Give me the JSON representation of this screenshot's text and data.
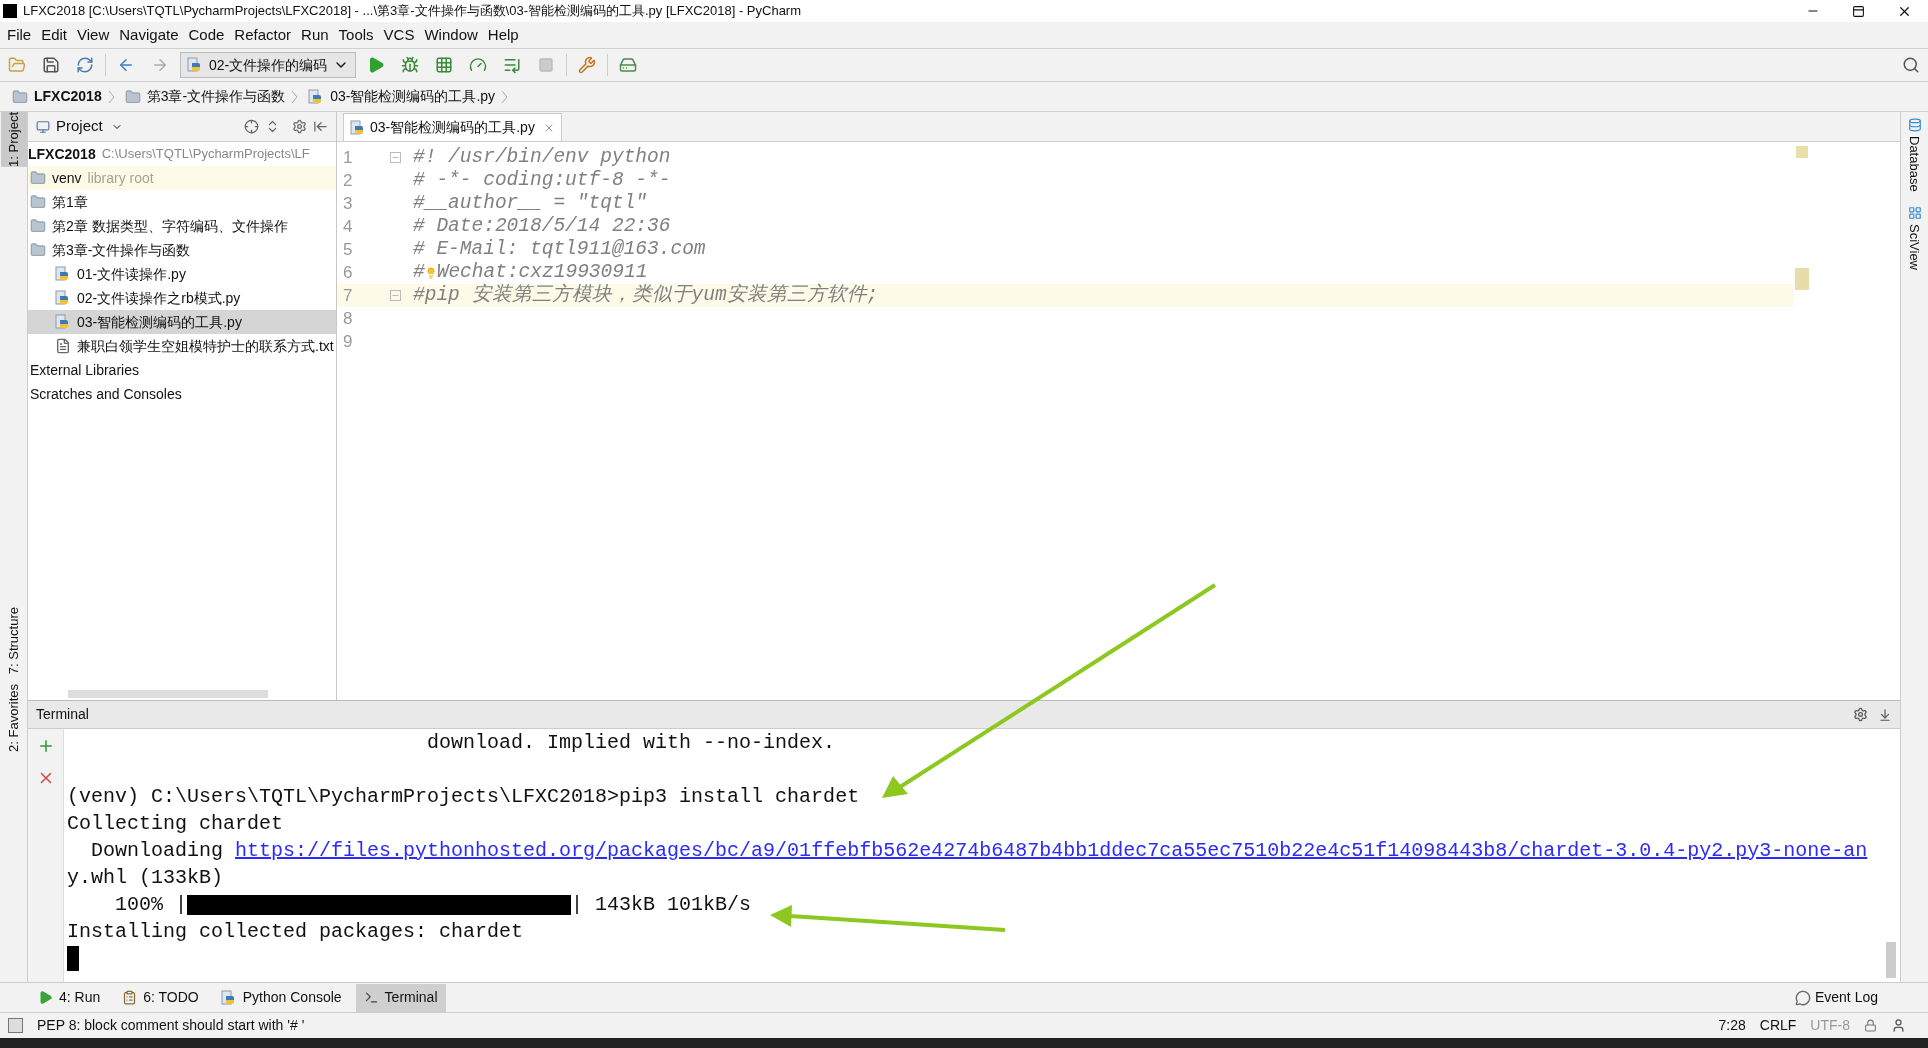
{
  "window": {
    "title": "LFXC2018 [C:\\Users\\TQTL\\PycharmProjects\\LFXC2018] - ...\\第3章-文件操作与函数\\03-智能检测编码的工具.py [LFXC2018] - PyCharm"
  },
  "menu": [
    "File",
    "Edit",
    "View",
    "Navigate",
    "Code",
    "Refactor",
    "Run",
    "Tools",
    "VCS",
    "Window",
    "Help"
  ],
  "run_config": "02-文件操作的编码",
  "breadcrumbs": [
    {
      "label": "LFXC2018",
      "kind": "folder"
    },
    {
      "label": "第3章-文件操作与函数",
      "kind": "folder"
    },
    {
      "label": "03-智能检测编码的工具.py",
      "kind": "python"
    }
  ],
  "left_tool_tabs": [
    {
      "label": "1: Project",
      "selected": true
    },
    {
      "label": "7: Structure",
      "selected": false
    },
    {
      "label": "2: Favorites",
      "selected": false
    }
  ],
  "right_tool_tabs": [
    "Database",
    "SciView"
  ],
  "project_panel": {
    "title": "Project",
    "root": {
      "name": "LFXC2018",
      "path": "C:\\Users\\TQTL\\PycharmProjects\\LF"
    },
    "tree": [
      {
        "name": "venv",
        "note": "library root",
        "kind": "folder",
        "selected": false
      },
      {
        "name": "第1章",
        "kind": "folder",
        "selected": false
      },
      {
        "name": "第2章 数据类型、字符编码、文件操作",
        "kind": "folder",
        "selected": false
      },
      {
        "name": "第3章-文件操作与函数",
        "kind": "folder",
        "selected": false,
        "children": [
          {
            "name": "01-文件读操作.py",
            "kind": "python",
            "selected": false
          },
          {
            "name": "02-文件读操作之rb模式.py",
            "kind": "python",
            "selected": false
          },
          {
            "name": "03-智能检测编码的工具.py",
            "kind": "python",
            "selected": true
          },
          {
            "name": "兼职白领学生空姐模特护士的联系方式.txt",
            "kind": "text",
            "selected": false
          }
        ]
      },
      {
        "name": "External Libraries",
        "kind": "node",
        "selected": false
      },
      {
        "name": "Scratches and Consoles",
        "kind": "node",
        "selected": false
      }
    ]
  },
  "editor": {
    "tabs": [
      {
        "label": "03-智能检测编码的工具.py",
        "selected": true
      }
    ],
    "lines": [
      {
        "number": "1",
        "text": "#! /usr/bin/env python",
        "fold": true,
        "current": false,
        "bulb": false
      },
      {
        "number": "2",
        "text": "# -*- coding:utf-8 -*-",
        "fold": false,
        "current": false,
        "bulb": false
      },
      {
        "number": "3",
        "text": "#__author__ = \"tqtl\"",
        "fold": false,
        "current": false,
        "bulb": false
      },
      {
        "number": "4",
        "text": "# Date:2018/5/14 22:36",
        "fold": false,
        "current": false,
        "bulb": false
      },
      {
        "number": "5",
        "text": "# E-Mail: tqtl911@163.com",
        "fold": false,
        "current": false,
        "bulb": false
      },
      {
        "number": "6",
        "text": "#",
        "after_bulb": "Wechat:cxz19930911",
        "fold": false,
        "current": false,
        "bulb": true
      },
      {
        "number": "7",
        "text": "#pip 安装第三方模块，类似于yum安装第三方软件;",
        "fold": true,
        "current": true,
        "bulb": false
      },
      {
        "number": "8",
        "fold": false,
        "current": false,
        "bulb": false
      },
      {
        "number": "9",
        "fold": false,
        "current": false,
        "bulb": false
      }
    ]
  },
  "terminal": {
    "title": "Terminal",
    "lines": [
      {
        "kind": "output",
        "text": "                              download. Implied with --no-index."
      },
      {
        "kind": "prompt",
        "text": "(venv) C:\\Users\\TQTL\\PycharmProjects\\LFXC2018>pip3 install chardet"
      },
      {
        "kind": "output",
        "text": "Collecting chardet"
      },
      {
        "kind": "link",
        "text": "  Downloading ",
        "url": "https://files.pythonhosted.org/packages/bc/a9/01ffebfb562e4274b6487b4bb1ddec7ca55ec7510b22e4c51f14098443b8/chardet-3.0.4-py2.py3-none-an"
      },
      {
        "kind": "output",
        "text": "y.whl (133kB)"
      },
      {
        "kind": "progress",
        "text": "    100% |",
        "level": 1,
        "suffix": "| 143kB 101kB/s"
      },
      {
        "kind": "output",
        "text": "Installing collected packages: chardet"
      },
      {
        "kind": "cursor"
      }
    ]
  },
  "bottom_tabs": [
    {
      "label": "4: Run",
      "kind": "run",
      "selected": false
    },
    {
      "label": "6: TODO",
      "kind": "todo",
      "selected": false
    },
    {
      "label": "Python Console",
      "kind": "console",
      "selected": false
    },
    {
      "label": "Terminal",
      "kind": "terminal",
      "selected": true
    }
  ],
  "event_log": "Event Log",
  "status_bar": {
    "message": "PEP 8: block comment should start with '# '",
    "position": "7:28",
    "line_separator": "CRLF",
    "encoding": "UTF-8"
  }
}
